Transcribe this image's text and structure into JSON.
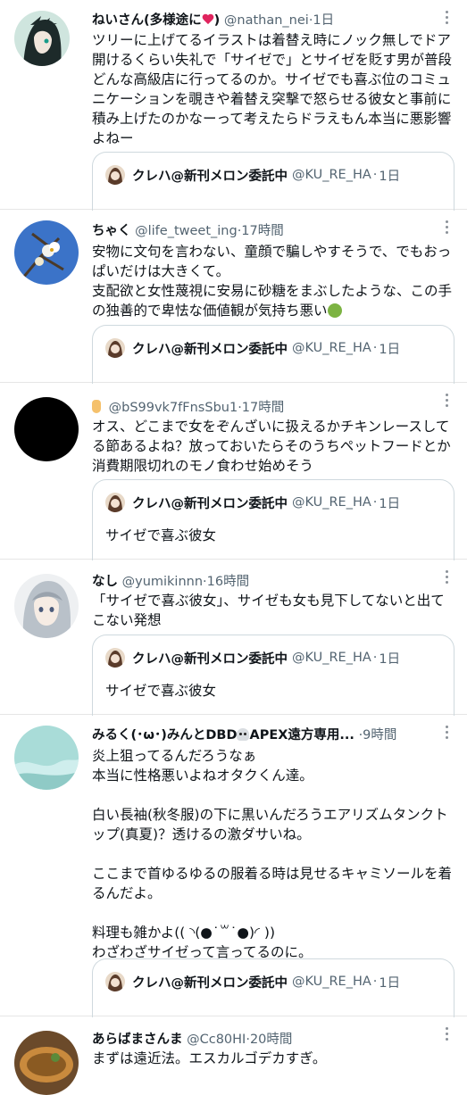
{
  "tweets": [
    {
      "name": "ねいさん(多様途に",
      "name_suffix": ")",
      "handle": "@nathan_nei",
      "time": "1日",
      "body": "ツリーに上げてるイラストは着替え時にノック無しでドア開けるくらい失礼で「サイゼで」とサイゼを貶す男が普段どんな高級店に行ってるのか。サイゼでも喜ぶ位のコミュニケーションを覗きや着替え突撃で怒らせる彼女と事前に積み上げたのかなーって考えたらドラえもん本当に悪影響よねー",
      "quote": {
        "name": "クレハ@新刊メロン委託中",
        "handle": "@KU_RE_HA",
        "time": "1日",
        "text": ""
      }
    },
    {
      "name": "ちゃく",
      "handle": "@life_tweet_ing",
      "time": "17時間",
      "body": "安物に文句を言わない、童顔で騙しやすそうで、でもおっぱいだけは大きくて。\n支配欲と女性蔑視に安易に砂糖をまぶしたような、この手の独善的で卑怯な価値観が気持ち悪い",
      "quote": {
        "name": "クレハ@新刊メロン委託中",
        "handle": "@KU_RE_HA",
        "time": "1日",
        "text": ""
      }
    },
    {
      "name": "",
      "handle": "@bS99vk7fFnsSbu1",
      "time": "17時間",
      "body": "オス、どこまで女をぞんざいに扱えるかチキンレースしてる節あるよね？放っておいたらそのうちペットフードとか消費期限切れのモノ食わせ始めそう",
      "quote": {
        "name": "クレハ@新刊メロン委託中",
        "handle": "@KU_RE_HA",
        "time": "1日",
        "text": "サイゼで喜ぶ彼女"
      }
    },
    {
      "name": "なし",
      "handle": "@yumikinnn",
      "time": "16時間",
      "body": "「サイゼで喜ぶ彼女」、サイゼも女も見下してないと出てこない発想",
      "quote": {
        "name": "クレハ@新刊メロン委託中",
        "handle": "@KU_RE_HA",
        "time": "1日",
        "text": "サイゼで喜ぶ彼女"
      }
    },
    {
      "name": "みるく(･ω･)みんとDBD",
      "name_suffix": "APEX遠方専用...",
      "handle": "",
      "time": "9時間",
      "body": "炎上狙ってるんだろうなぁ\n本当に性格悪いよねオタクくん達。\n\n白い長袖(秋冬服)の下に黒いんだろうエアリズムタンクトップ(真夏)？透けるの激ダサいね。\n\nここまで首ゆるゆるの服着る時は見せるキャミソールを着るんだよ。\n\n料理も雑かよ(( ◝(●˙꒳˙●)◜ ))\nわざわざサイゼって言ってるのに。",
      "quote": {
        "name": "クレハ@新刊メロン委託中",
        "handle": "@KU_RE_HA",
        "time": "1日",
        "text": ""
      }
    },
    {
      "name": "あらばまさんま",
      "handle": "@Cc80HI",
      "time": "20時間",
      "body": "まずは遠近法。エスカルゴデカすぎ。",
      "quote": null
    }
  ],
  "separator": "·",
  "icons": [
    "more-icon",
    "heart-emoji",
    "skull-emoji",
    "nauseated-face-emoji",
    "pointing-hand-emoji"
  ]
}
